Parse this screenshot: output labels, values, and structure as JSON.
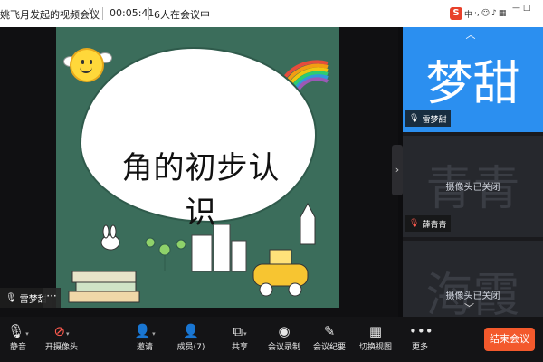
{
  "window": {
    "title": "姚飞月发起的视频会议",
    "timer": "00:05:41",
    "participants_in_meeting": "6人在会议中",
    "tray": {
      "ime": "S",
      "ime_lang": "中"
    }
  },
  "shared_screen": {
    "slide_title": "角的初步认识",
    "presenter_tag": "雷梦甜",
    "more": "···"
  },
  "sidebar": {
    "tiles": [
      {
        "avatar_text": "梦甜",
        "name": "雷梦甜",
        "camera_status": "",
        "muted": false
      },
      {
        "avatar_text": "青青",
        "name": "薛青青",
        "camera_status": "摄像头已关闭",
        "muted": true
      },
      {
        "avatar_text": "海霞",
        "name": "",
        "camera_status": "摄像头已关闭",
        "muted": false
      }
    ]
  },
  "toolbar": {
    "items": [
      {
        "label": "静音",
        "icon": "microphone-icon"
      },
      {
        "label": "开摄像头",
        "icon": "camera-off-icon"
      },
      {
        "label": "邀请",
        "icon": "add-user-icon"
      },
      {
        "label": "成员(7)",
        "icon": "members-icon"
      },
      {
        "label": "共享",
        "icon": "share-screen-icon"
      },
      {
        "label": "会议录制",
        "icon": "record-icon"
      },
      {
        "label": "会议纪要",
        "icon": "minutes-icon"
      },
      {
        "label": "切换视图",
        "icon": "grid-view-icon"
      },
      {
        "label": "更多",
        "icon": "more-icon"
      }
    ],
    "end_meeting": "结束会议"
  },
  "colors": {
    "end_button": "#f3592c",
    "active_tile": "#2b8ff0",
    "slide_background": "#3b6d5b"
  }
}
